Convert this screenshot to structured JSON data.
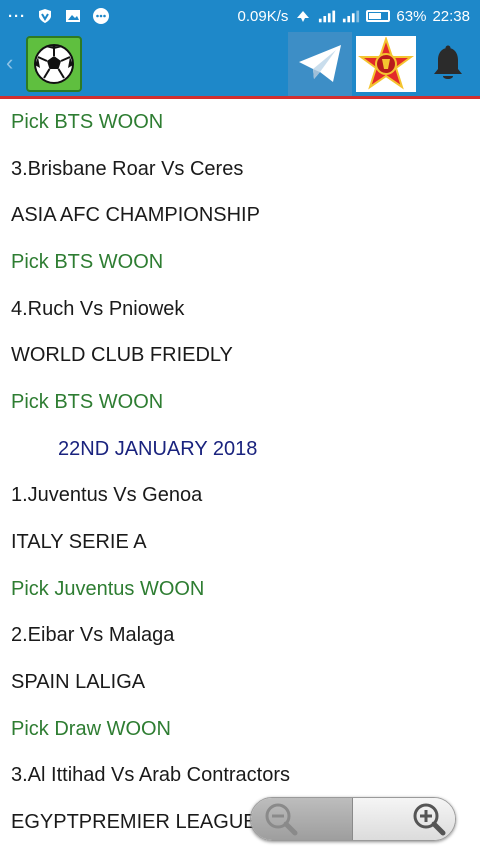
{
  "status_bar": {
    "dots": "···",
    "speed": "0.09K/s",
    "battery": "63%",
    "time": "22:38",
    "icons": [
      "shield-icon",
      "image-icon",
      "chat-icon",
      "data-icon",
      "signal-icon",
      "signal-icon",
      "battery-icon"
    ]
  },
  "app_bar": {
    "icons": [
      "back-chevron-icon",
      "soccer-ball-icon",
      "telegram-icon",
      "star-emblem-icon",
      "bell-icon"
    ]
  },
  "list": [
    {
      "text": "Pick BTS WOON",
      "kind": "pick"
    },
    {
      "text": "3.Brisbane Roar Vs Ceres",
      "kind": "match"
    },
    {
      "text": "ASIA AFC CHAMPIONSHIP",
      "kind": "league"
    },
    {
      "text": "Pick BTS WOON",
      "kind": "pick"
    },
    {
      "text": "4.Ruch Vs Pniowek",
      "kind": "match"
    },
    {
      "text": "WORLD CLUB FRIEDLY",
      "kind": "league"
    },
    {
      "text": "Pick BTS WOON",
      "kind": "pick"
    },
    {
      "text": "22ND JANUARY 2018",
      "kind": "date"
    },
    {
      "text": "1.Juventus Vs Genoa",
      "kind": "match"
    },
    {
      "text": "ITALY SERIE A",
      "kind": "league"
    },
    {
      "text": "Pick Juventus WOON",
      "kind": "pick"
    },
    {
      "text": "2.Eibar Vs Malaga",
      "kind": "match"
    },
    {
      "text": "SPAIN LALIGA",
      "kind": "league"
    },
    {
      "text": "Pick Draw WOON",
      "kind": "pick"
    },
    {
      "text": "3.Al Ittihad Vs Arab Contractors",
      "kind": "match"
    },
    {
      "text": "EGYPTPREMIER LEAGUE",
      "kind": "league"
    }
  ],
  "zoom": {
    "out_icon": "zoom-out-icon",
    "in_icon": "zoom-in-icon"
  },
  "colors": {
    "primary": "#1e88c9",
    "accent_line": "#d32f2f",
    "pick": "#2e7d32",
    "date": "#1a237e"
  }
}
